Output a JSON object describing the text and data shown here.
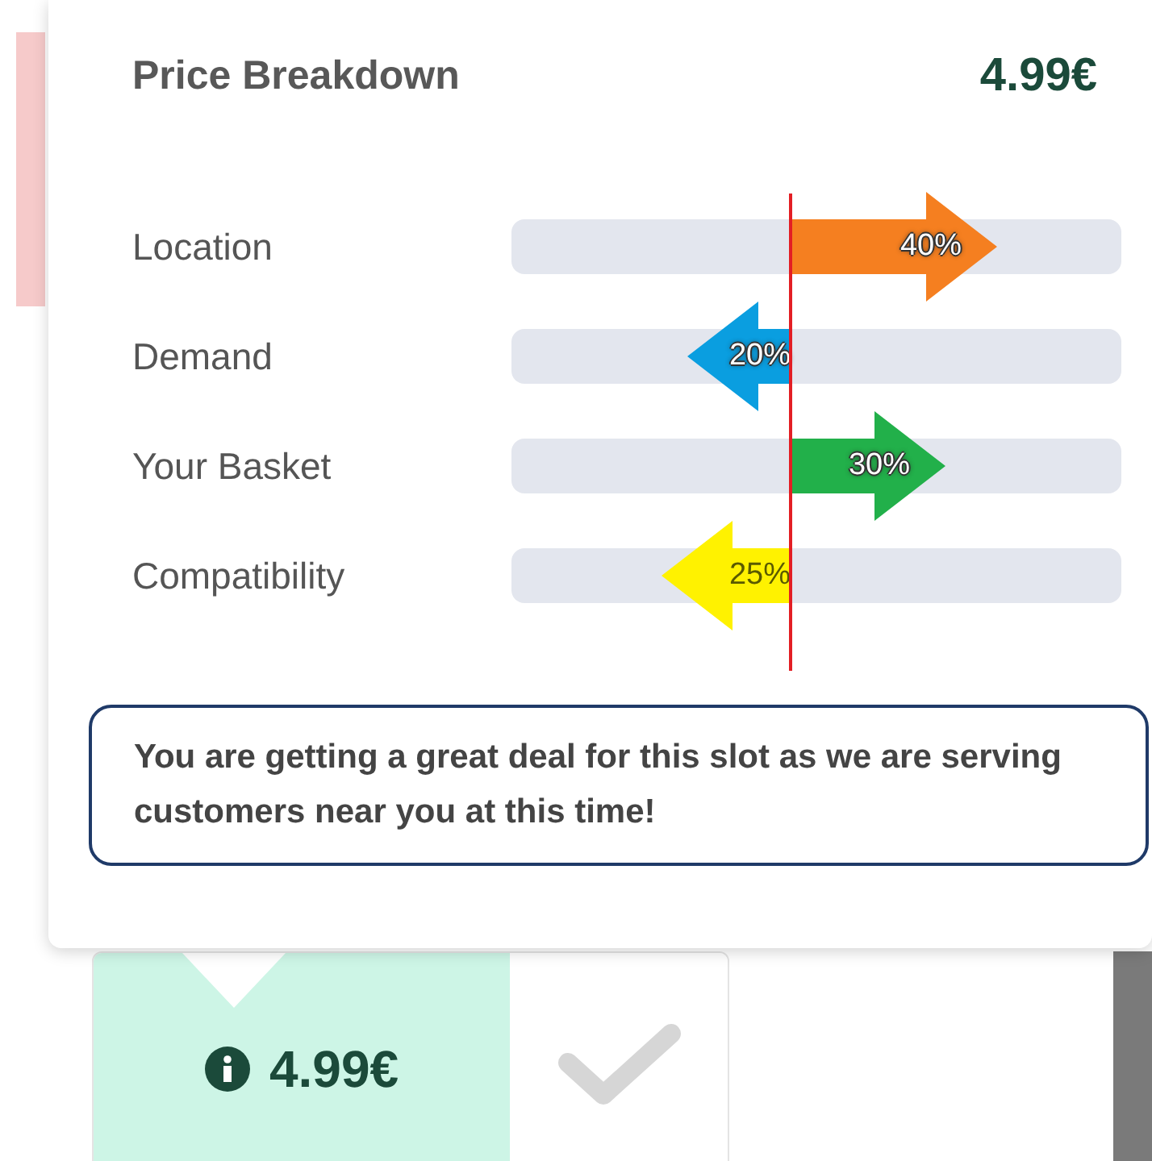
{
  "popover": {
    "title": "Price Breakdown",
    "price": "4.99€",
    "factors": [
      {
        "label": "Location",
        "kind": "increase",
        "value": "40%",
        "color": "#f57f20"
      },
      {
        "label": "Demand",
        "kind": "decrease",
        "value": "20%",
        "color": "#0a9ee0"
      },
      {
        "label": "Your Basket",
        "kind": "increase",
        "value": "30%",
        "color": "#22b04a"
      },
      {
        "label": "Compatibility",
        "kind": "decrease",
        "value": "25%",
        "color": "#fff200"
      }
    ],
    "message": "You are getting a great deal for this slot as we are serving customers near you at this time!"
  },
  "slot": {
    "price": "4.99€",
    "selected": false
  }
}
